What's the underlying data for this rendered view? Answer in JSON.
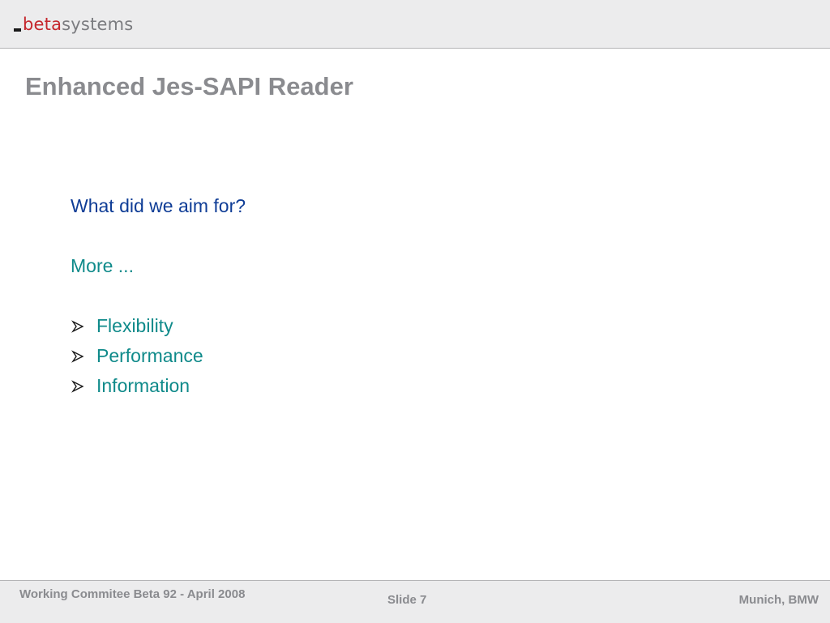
{
  "logo": {
    "beta": "beta",
    "systems": "systems",
    "colors": {
      "beta": "#c5262c",
      "systems": "#7b7c80",
      "dash": "#1a1a1a"
    }
  },
  "slide": {
    "title": "Enhanced Jes-SAPI Reader",
    "question": "What did we aim for?",
    "more": "More ...",
    "bullet_icon": "arrow-bullet-icon",
    "bullets": [
      {
        "label": "Flexibility"
      },
      {
        "label": "Performance"
      },
      {
        "label": "Information"
      }
    ]
  },
  "footer": {
    "left": "Working Commitee Beta 92 - April 2008",
    "center": "Slide 7",
    "right": "Munich, BMW"
  },
  "colors": {
    "title": "#8a8b8f",
    "question": "#0f3d96",
    "accent_teal": "#0f8a8a",
    "bar_background": "#ececed"
  }
}
